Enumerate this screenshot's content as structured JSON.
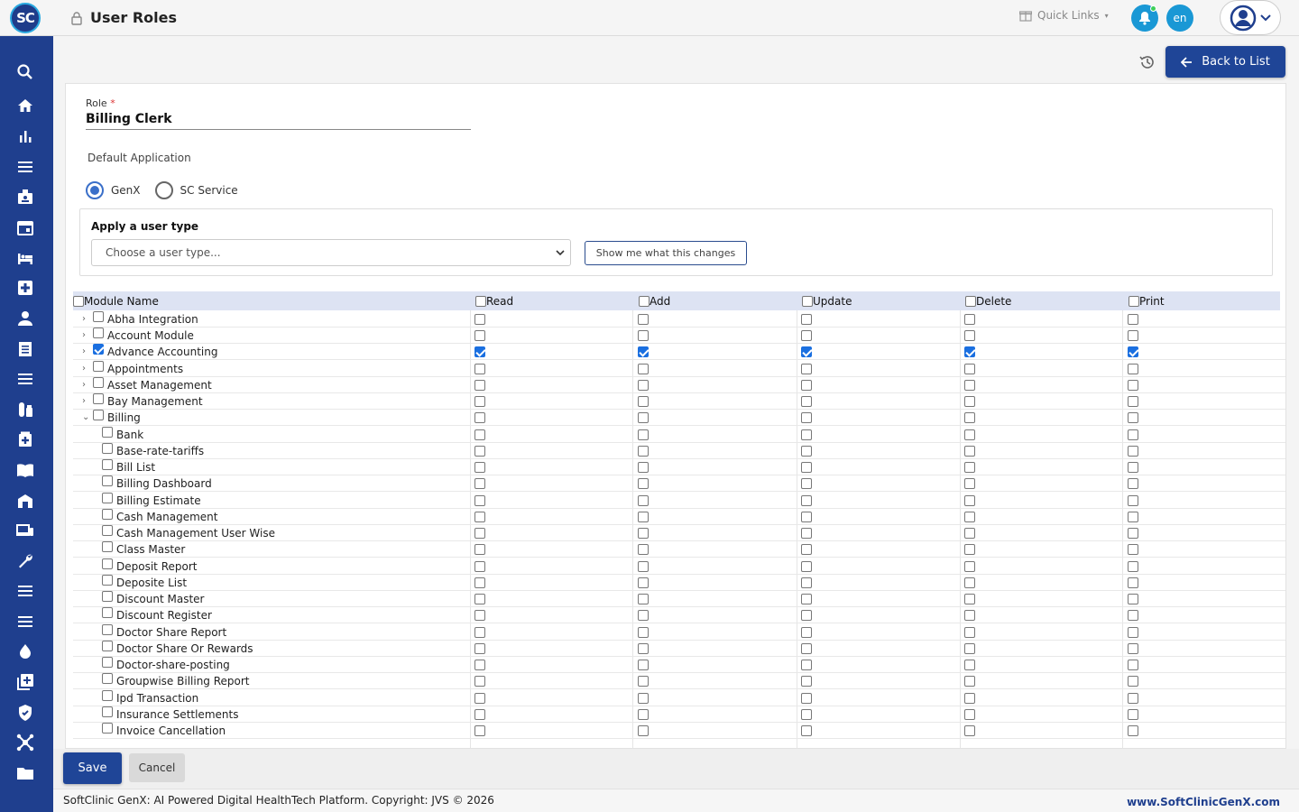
{
  "header": {
    "logo_text": "SC",
    "title": "User Roles",
    "quick_links": "Quick Links",
    "language": "en"
  },
  "sidebar": {
    "icons": [
      "search-icon",
      "home-icon",
      "chart-icon",
      "menu-icon",
      "badge-icon",
      "calendar-icon",
      "bed-icon",
      "medical-plus-icon",
      "person-icon",
      "list-doc-icon",
      "menu-icon",
      "pharmacy-icon",
      "medicine-box-icon",
      "book-icon",
      "store-icon",
      "devices-icon",
      "wrench-icon",
      "menu-icon",
      "menu-icon",
      "drop-icon",
      "add-box-icon",
      "shield-icon",
      "network-icon",
      "folder-icon"
    ]
  },
  "actions": {
    "back_label": "Back to List"
  },
  "form": {
    "role_label": "Role",
    "role_required": "*",
    "role_value": "Billing Clerk",
    "default_application_label": "Default Application",
    "radio_options": [
      {
        "label": "GenX",
        "selected": true
      },
      {
        "label": "SC Service",
        "selected": false
      }
    ],
    "user_type_title": "Apply a user type",
    "user_type_placeholder": "Choose a user type...",
    "show_changes_label": "Show me what this changes"
  },
  "grid": {
    "columns": [
      "Module Name",
      "Read",
      "Add",
      "Update",
      "Delete",
      "Print"
    ],
    "rows": [
      {
        "name": "Abha Integration",
        "level": 0,
        "expand": "collapsed",
        "checked": false
      },
      {
        "name": "Account Module",
        "level": 0,
        "expand": "collapsed",
        "checked": false
      },
      {
        "name": "Advance Accounting",
        "level": 0,
        "expand": "collapsed",
        "checked": true
      },
      {
        "name": "Appointments",
        "level": 0,
        "expand": "collapsed",
        "checked": false
      },
      {
        "name": "Asset Management",
        "level": 0,
        "expand": "collapsed",
        "checked": false
      },
      {
        "name": "Bay Management",
        "level": 0,
        "expand": "collapsed",
        "checked": false
      },
      {
        "name": "Billing",
        "level": 0,
        "expand": "expanded",
        "checked": false
      },
      {
        "name": "Bank",
        "level": 1,
        "checked": false
      },
      {
        "name": "Base-rate-tariffs",
        "level": 1,
        "checked": false
      },
      {
        "name": "Bill List",
        "level": 1,
        "checked": false
      },
      {
        "name": "Billing Dashboard",
        "level": 1,
        "checked": false
      },
      {
        "name": "Billing Estimate",
        "level": 1,
        "checked": false
      },
      {
        "name": "Cash Management",
        "level": 1,
        "checked": false
      },
      {
        "name": "Cash Management User Wise",
        "level": 1,
        "checked": false
      },
      {
        "name": "Class Master",
        "level": 1,
        "checked": false
      },
      {
        "name": "Deposit Report",
        "level": 1,
        "checked": false
      },
      {
        "name": "Deposite List",
        "level": 1,
        "checked": false
      },
      {
        "name": "Discount Master",
        "level": 1,
        "checked": false
      },
      {
        "name": "Discount Register",
        "level": 1,
        "checked": false
      },
      {
        "name": "Doctor Share Report",
        "level": 1,
        "checked": false
      },
      {
        "name": "Doctor Share Or Rewards",
        "level": 1,
        "checked": false
      },
      {
        "name": "Doctor-share-posting",
        "level": 1,
        "checked": false
      },
      {
        "name": "Groupwise Billing Report",
        "level": 1,
        "checked": false
      },
      {
        "name": "Ipd Transaction",
        "level": 1,
        "checked": false
      },
      {
        "name": "Insurance Settlements",
        "level": 1,
        "checked": false
      },
      {
        "name": "Invoice Cancellation",
        "level": 1,
        "checked": false
      }
    ]
  },
  "bottom": {
    "save_label": "Save",
    "cancel_label": "Cancel"
  },
  "footer": {
    "left": "SoftClinic GenX: AI Powered Digital HealthTech Platform. Copyright: JVS © 2026",
    "right": "www.SoftClinicGenX.com"
  },
  "colors": {
    "primary": "#1f4597",
    "sidebar": "#1f3f8e",
    "accent": "#1a98d5",
    "checkbox_checked": "#1a6fe0"
  }
}
